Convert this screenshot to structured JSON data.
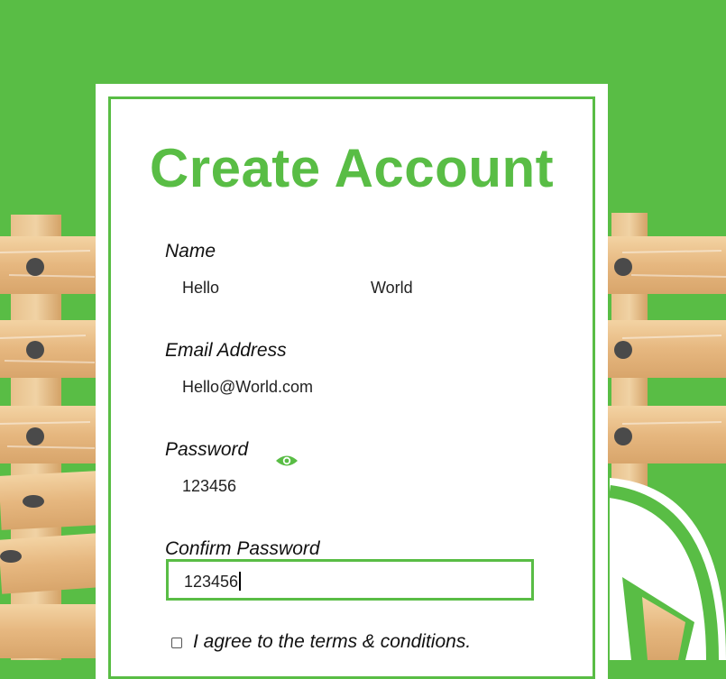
{
  "page": {
    "title": "Create Account",
    "accent_color": "#59bd45"
  },
  "form": {
    "name": {
      "label": "Name",
      "first_value": "Hello",
      "last_value": "World"
    },
    "email": {
      "label": "Email Address",
      "value": "Hello@World.com"
    },
    "password": {
      "label": "Password",
      "value": "123456",
      "toggle_icon": "eye-icon"
    },
    "confirm_password": {
      "label": "Confirm Password",
      "value": "123456"
    },
    "terms": {
      "label": "I agree to the terms & conditions.",
      "checked": false
    }
  }
}
